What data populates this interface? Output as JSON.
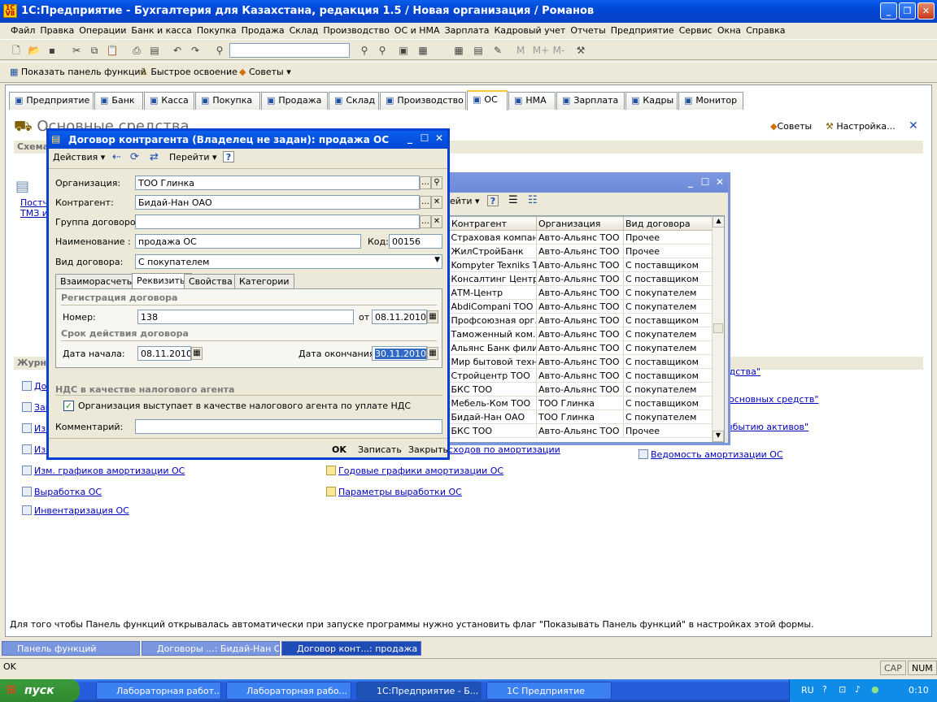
{
  "window": {
    "title": "1С:Предприятие - Бухгалтерия для Казахстана, редакция 1.5 / Новая организация / Романов",
    "icon_text": "1С V8"
  },
  "menu": [
    "Файл",
    "Правка",
    "Операции",
    "Банк и касса",
    "Покупка",
    "Продажа",
    "Склад",
    "Производство",
    "ОС и НМА",
    "Зарплата",
    "Кадровый учет",
    "Отчеты",
    "Предприятие",
    "Сервис",
    "Окна",
    "Справка"
  ],
  "toolbar2": {
    "show_panel": "Показать панель функций",
    "quick": "Быстрое освоение",
    "tips": "Советы"
  },
  "tabs": [
    {
      "label": "Предприятие",
      "icon": "enterprise-icon"
    },
    {
      "label": "Банк",
      "icon": "bank-icon"
    },
    {
      "label": "Касса",
      "icon": "cash-icon"
    },
    {
      "label": "Покупка",
      "icon": "purchase-icon"
    },
    {
      "label": "Продажа",
      "icon": "sale-icon"
    },
    {
      "label": "Склад",
      "icon": "warehouse-icon"
    },
    {
      "label": "Производство",
      "icon": "production-icon"
    },
    {
      "label": "ОС",
      "icon": "truck-icon"
    },
    {
      "label": "НМА",
      "icon": "nma-icon"
    },
    {
      "label": "Зарплата",
      "icon": "salary-icon"
    },
    {
      "label": "Кадры",
      "icon": "staff-icon"
    },
    {
      "label": "Монитор",
      "icon": "monitor-icon"
    }
  ],
  "selected_tab": "ОС",
  "panel": {
    "title": "Основные средства",
    "tips": "Советы",
    "settings": "Настройка...",
    "schema": "Схема",
    "schema_link_1": "Постч",
    "schema_link_2": "ТМЗ и",
    "journals": "Журнал",
    "left_links": [
      "До",
      "Зак",
      "Изм",
      "Изм. способов отражения расходов по аморт. ОС",
      "Изм. графиков амортизации ОС",
      "Выработка ОС",
      "Инвентаризация ОС"
    ],
    "mid_links": [
      "Способы отражения расходов по амортизации",
      "Годовые графики амортизации ОС",
      "Параметры выработки ОС"
    ],
    "right_links": [
      "0 \"Основные средства\"",
      "0 \"Амортизация основных средств\"",
      "0 \"Расходы по выбытию активов\"",
      "Ведомость амортизации ОС"
    ],
    "hint": "Для того чтобы Панель функций открывалась автоматически при запуске программы нужно установить флаг \"Показывать Панель функций\" в настройках этой формы."
  },
  "list_window": {
    "toolbar_go": "ейти",
    "columns": [
      "Контрагент",
      "Организация",
      "Вид договора"
    ],
    "rows": [
      [
        "Страховая компан...",
        "Авто-Альянс ТОО",
        "Прочее"
      ],
      [
        "ЖилСтройБанк",
        "Авто-Альянс ТОО",
        "Прочее"
      ],
      [
        "Kompyter Texniks T...",
        "Авто-Альянс ТОО",
        "С поставщиком"
      ],
      [
        "Консалтинг Центр...",
        "Авто-Альянс ТОО",
        "С поставщиком"
      ],
      [
        "АТМ-Центр",
        "Авто-Альянс ТОО",
        "С покупателем"
      ],
      [
        "AbdiCompani ТОО",
        "Авто-Альянс ТОО",
        "С покупателем"
      ],
      [
        "Профсоюзная орг...",
        "Авто-Альянс ТОО",
        "С поставщиком"
      ],
      [
        "Таможенный ком...",
        "Авто-Альянс ТОО",
        "С покупателем"
      ],
      [
        "Альянс Банк фили...",
        "Авто-Альянс ТОО",
        "С покупателем"
      ],
      [
        "Мир бытовой техн...",
        "Авто-Альянс ТОО",
        "С поставщиком"
      ],
      [
        "Стройцентр ТОО",
        "Авто-Альянс ТОО",
        "С поставщиком"
      ],
      [
        "БКС ТОО",
        "Авто-Альянс ТОО",
        "С покупателем"
      ],
      [
        "Мебель-Ком ТОО",
        "ТОО Глинка",
        "С поставщиком"
      ],
      [
        "Бидай-Нан ОАО",
        "ТОО Глинка",
        "С покупателем"
      ],
      [
        "БКС ТОО",
        "Авто-Альянс ТОО",
        "Прочее"
      ]
    ]
  },
  "dialog": {
    "title": "Договор контрагента (Владелец не задан): продажа ОС",
    "actions": "Действия",
    "goto": "Перейти",
    "org_label": "Организация:",
    "org_value": "ТОО Глинка",
    "contractor_label": "Контрагент:",
    "contractor_value": "Бидай-Нан ОАО",
    "group_label": "Группа договоров:",
    "group_value": "",
    "name_label": "Наименование :",
    "name_value": "продажа ОС",
    "code_label": "Код:",
    "code_value": "00156",
    "kind_label": "Вид договора:",
    "kind_value": "С покупателем",
    "tabs": [
      "Взаиморасчеты",
      "Реквизиты",
      "Свойства",
      "Категории"
    ],
    "selected_tab": "Реквизиты",
    "reg_group": "Регистрация договора",
    "number_label": "Номер:",
    "number_value": "138",
    "from_label": "от",
    "from_value": "08.11.2010",
    "term_group": "Срок действия договора",
    "start_label": "Дата начала:",
    "start_value": "08.11.2010",
    "end_label": "Дата окончания:",
    "end_value": "30.11.2010",
    "vat_group": "НДС в качестве налогового агента",
    "vat_check": "Организация выступает в качестве налогового агента по уплате НДС",
    "vat_checked": true,
    "comment_label": "Комментарий:",
    "comment_value": "",
    "ok": "OK",
    "save": "Записать",
    "close": "Закрыть"
  },
  "mdi_windows": [
    "Панель функций",
    "Договоры ...: Бидай-Нан ОАО",
    "Договор конт...: продажа ОС"
  ],
  "status": {
    "text": "OK",
    "cap": "CAP",
    "num": "NUM"
  },
  "taskbar": {
    "start": "пуск",
    "items": [
      "Лабораторная работ...",
      "Лабораторная рабо...",
      "1С:Предприятие - Б...",
      "1С Предприятие"
    ],
    "lang": "RU",
    "time": "0:10"
  }
}
